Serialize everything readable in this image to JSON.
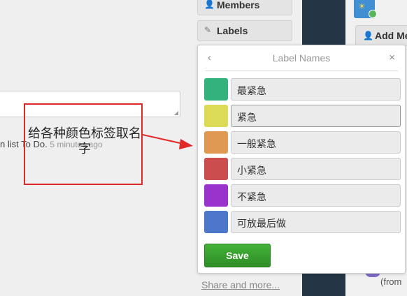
{
  "sidebar": {
    "members_label": "Members",
    "labels_label": "Labels",
    "share_label": "Share and more..."
  },
  "right_panel": {
    "add_members_label": "Add Mem",
    "from_text": "(from"
  },
  "activity": {
    "text": "n list To Do.",
    "time": "5 minutes ago"
  },
  "annotation": {
    "text": "给各种颜色标签取名字"
  },
  "popover": {
    "title": "Label Names",
    "back_icon": "‹",
    "close_icon": "×",
    "labels": [
      {
        "color": "#34b27d",
        "name": "最紧急"
      },
      {
        "color": "#dbdb57",
        "name": "紧急"
      },
      {
        "color": "#e09952",
        "name": "一般紧急"
      },
      {
        "color": "#cb4d4d",
        "name": "小紧急"
      },
      {
        "color": "#9933cc",
        "name": "不紧急"
      },
      {
        "color": "#4d77cb",
        "name": "可放最后做"
      }
    ],
    "save_label": "Save"
  },
  "icons": {
    "members": "person-icon",
    "labels": "tag-icon",
    "back": "chevron-left-icon",
    "close": "close-icon"
  }
}
